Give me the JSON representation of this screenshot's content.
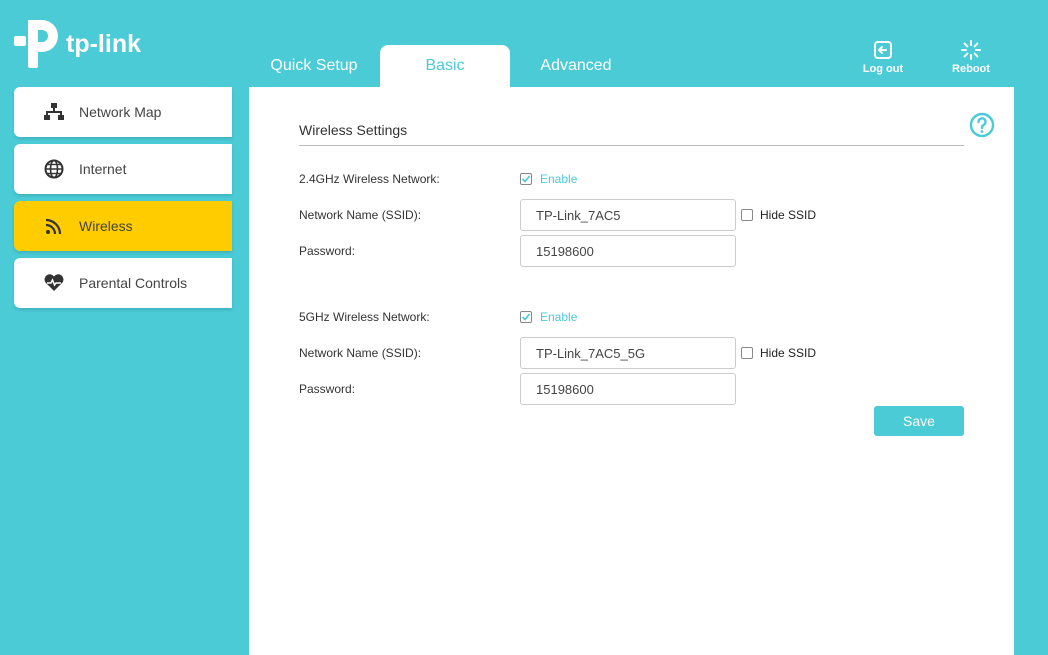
{
  "brand": {
    "name": "tp-link"
  },
  "tabs": [
    {
      "label": "Quick Setup",
      "active": false
    },
    {
      "label": "Basic",
      "active": true
    },
    {
      "label": "Advanced",
      "active": false
    }
  ],
  "top_actions": {
    "logout_label": "Log out",
    "reboot_label": "Reboot"
  },
  "sidebar": {
    "items": [
      {
        "label": "Network Map",
        "icon": "network-map-icon",
        "active": false
      },
      {
        "label": "Internet",
        "icon": "globe-icon",
        "active": false
      },
      {
        "label": "Wireless",
        "icon": "wifi-icon",
        "active": true
      },
      {
        "label": "Parental Controls",
        "icon": "heart-icon",
        "active": false
      }
    ]
  },
  "main": {
    "section_title": "Wireless Settings",
    "band_24": {
      "label": "2.4GHz Wireless Network:",
      "enable_label": "Enable",
      "enabled": true,
      "ssid_label": "Network Name (SSID):",
      "ssid_value": "TP-Link_7AC5",
      "hide_ssid_label": "Hide SSID",
      "hide_ssid": false,
      "password_label": "Password:",
      "password_value": "15198600"
    },
    "band_5": {
      "label": "5GHz Wireless Network:",
      "enable_label": "Enable",
      "enabled": true,
      "ssid_label": "Network Name (SSID):",
      "ssid_value": "TP-Link_7AC5_5G",
      "hide_ssid_label": "Hide SSID",
      "hide_ssid": false,
      "password_label": "Password:",
      "password_value": "15198600"
    },
    "save_label": "Save"
  },
  "colors": {
    "accent": "#4acbd6",
    "active_nav": "#ffcc00"
  }
}
